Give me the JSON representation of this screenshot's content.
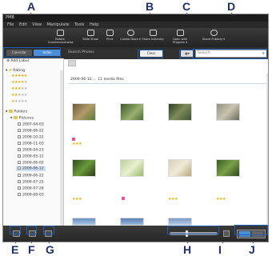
{
  "callouts": [
    "A",
    "B",
    "C",
    "D",
    "E",
    "F",
    "G",
    "H",
    "I",
    "J"
  ],
  "window": {
    "title": "PMB",
    "menu": [
      "File",
      "Edit",
      "View",
      "Manipulate",
      "Tools",
      "Help"
    ]
  },
  "toolbar": {
    "items": [
      "Rotate Counterclockwise",
      "Slide Show",
      "Print",
      "Create Discs ▾",
      "Share Instantly",
      "Open with Program ▾",
      "Share Publicly ▾"
    ]
  },
  "tabs": {
    "calendar": "Calendar",
    "index": "Index"
  },
  "sidebar": {
    "add_label": "Add Label",
    "rating_header": "Rating",
    "folders_header": "Folders",
    "pictures": "Pictures",
    "dates": [
      "2007-04-03",
      "2008-06-22",
      "2008-10-22",
      "2008-11-03",
      "2009-04-23",
      "2009-05-12",
      "2009-06-02",
      "2009-06-12",
      "2009-06-22",
      "2009-07-25",
      "2009-07-28",
      "2009-08-03"
    ]
  },
  "searchbar": {
    "label": "Search  Photos",
    "clear": "Clear",
    "placeholder": "Search"
  },
  "main": {
    "date_header": "2009-06-12 … 11 media files"
  },
  "colors": {
    "callout": "#1a2f6b",
    "highlight": "#1e5fb8",
    "star": "#e8b000"
  }
}
